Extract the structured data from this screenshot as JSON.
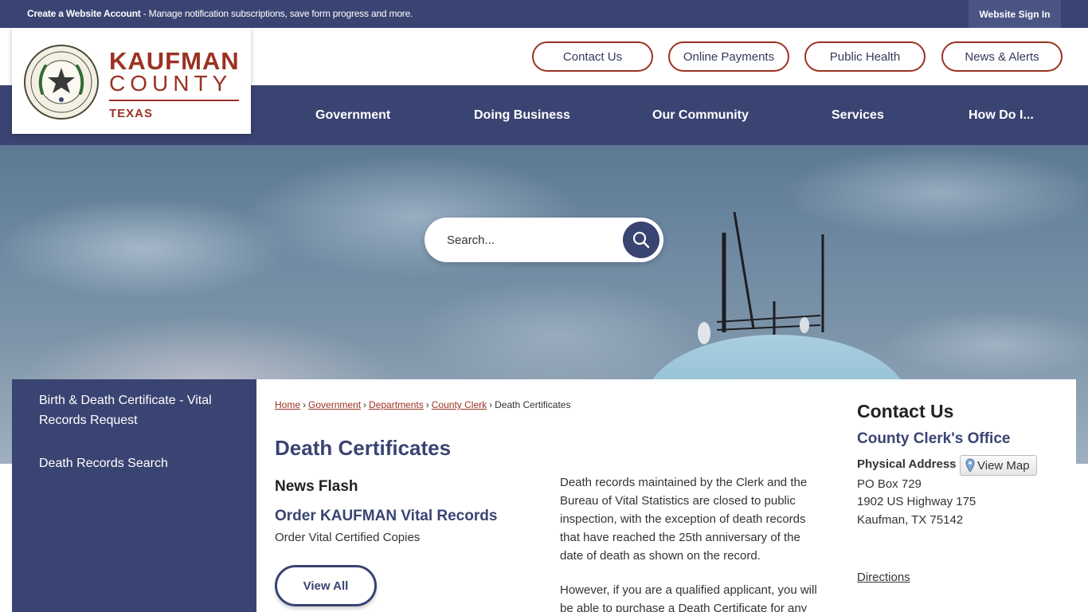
{
  "topbar": {
    "account_bold": "Create a Website Account",
    "account_rest": " - Manage notification subscriptions, save form progress and more.",
    "signin": "Website Sign In"
  },
  "logo": {
    "name": "KAUFMAN",
    "county": "COUNTY",
    "state": "TEXAS"
  },
  "quick_links": [
    "Contact Us",
    "Online Payments",
    "Public Health",
    "News & Alerts"
  ],
  "nav": [
    "Government",
    "Doing Business",
    "Our Community",
    "Services",
    "How Do I..."
  ],
  "search": {
    "placeholder": "Search..."
  },
  "sidebar": {
    "items": [
      "Birth & Death Certificate - Vital Records Request",
      "Death Records Search"
    ]
  },
  "breadcrumb": {
    "links": [
      "Home",
      "Government",
      "Departments",
      "County Clerk"
    ],
    "current": "Death Certificates",
    "separator": "›"
  },
  "page": {
    "title": "Death Certificates",
    "news_flash": {
      "heading": "News Flash",
      "item_title": "Order KAUFMAN Vital Records",
      "item_sub": "Order Vital Certified Copies",
      "view_all": "View All"
    },
    "paragraph1": "Death records maintained by the Clerk and the Bureau of Vital Statistics are closed to public inspection, with the exception of death records that have reached the 25th anniversary of the date of death as shown on the record.",
    "paragraph2": "However, if you are a qualified applicant, you will be able to purchase a Death Certificate for any"
  },
  "contact": {
    "heading": "Contact Us",
    "office": "County Clerk's Office",
    "address_label": "Physical Address",
    "view_map": "View Map",
    "lines": [
      "PO Box 729",
      "1902 US Highway 175",
      "Kaufman, TX 75142"
    ],
    "directions": "Directions"
  },
  "colors": {
    "navy": "#3a4472",
    "brick": "#9b3223"
  },
  "icons": {
    "search": "search-icon",
    "map_pin": "map-pin-icon",
    "seal": "county-seal-logo"
  }
}
